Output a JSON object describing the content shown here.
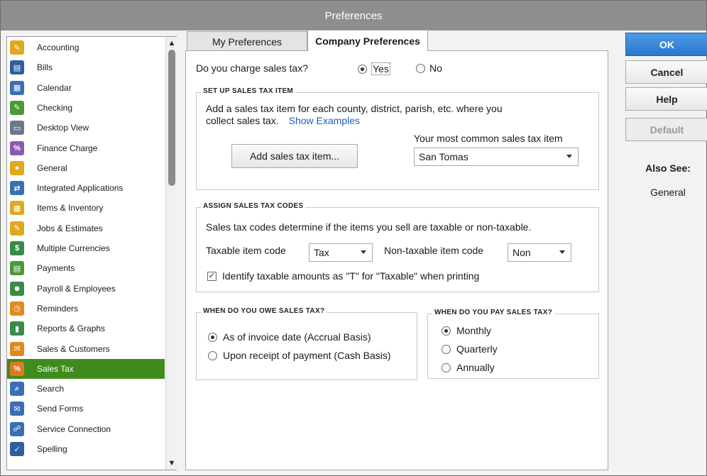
{
  "window": {
    "title": "Preferences"
  },
  "sidebar": {
    "items": [
      {
        "label": "Accounting",
        "icon": "accounting-icon",
        "color": "#e0a81e",
        "glyph": "✎"
      },
      {
        "label": "Bills",
        "icon": "bills-icon",
        "color": "#2e5e9e",
        "glyph": "▤"
      },
      {
        "label": "Calendar",
        "icon": "calendar-icon",
        "color": "#3a6eb5",
        "glyph": "▦"
      },
      {
        "label": "Checking",
        "icon": "checking-icon",
        "color": "#4a9a3a",
        "glyph": "✎"
      },
      {
        "label": "Desktop View",
        "icon": "desktop-view-icon",
        "color": "#6a7a8a",
        "glyph": "▭"
      },
      {
        "label": "Finance Charge",
        "icon": "finance-charge-icon",
        "color": "#8a5ab0",
        "glyph": "%"
      },
      {
        "label": "General",
        "icon": "general-icon",
        "color": "#e0a81e",
        "glyph": "●"
      },
      {
        "label": "Integrated Applications",
        "icon": "integrated-applications-icon",
        "color": "#3a6eb5",
        "glyph": "⇄"
      },
      {
        "label": "Items & Inventory",
        "icon": "items-inventory-icon",
        "color": "#e0a81e",
        "glyph": "▩"
      },
      {
        "label": "Jobs & Estimates",
        "icon": "jobs-estimates-icon",
        "color": "#e0a81e",
        "glyph": "✎"
      },
      {
        "label": "Multiple Currencies",
        "icon": "multiple-currencies-icon",
        "color": "#3b8a4a",
        "glyph": "$"
      },
      {
        "label": "Payments",
        "icon": "payments-icon",
        "color": "#4a9a3a",
        "glyph": "▤"
      },
      {
        "label": "Payroll & Employees",
        "icon": "payroll-employees-icon",
        "color": "#3b8a4a",
        "glyph": "☻"
      },
      {
        "label": "Reminders",
        "icon": "reminders-icon",
        "color": "#e08a1e",
        "glyph": "◷"
      },
      {
        "label": "Reports & Graphs",
        "icon": "reports-graphs-icon",
        "color": "#3b8a4a",
        "glyph": "▮"
      },
      {
        "label": "Sales & Customers",
        "icon": "sales-customers-icon",
        "color": "#e08a1e",
        "glyph": "✉"
      },
      {
        "label": "Sales Tax",
        "icon": "sales-tax-icon",
        "color": "#e07a1e",
        "glyph": "%"
      },
      {
        "label": "Search",
        "icon": "search-icon",
        "color": "#3a6eb5",
        "glyph": "⌕"
      },
      {
        "label": "Send Forms",
        "icon": "send-forms-icon",
        "color": "#3a6eb5",
        "glyph": "✉"
      },
      {
        "label": "Service Connection",
        "icon": "service-connection-icon",
        "color": "#3a6eb5",
        "glyph": "☍"
      },
      {
        "label": "Spelling",
        "icon": "spelling-icon",
        "color": "#2e5e9e",
        "glyph": "✓"
      }
    ],
    "selected_index": 16,
    "selected_color": "#3f8c1e"
  },
  "tabs": [
    {
      "label": "My Preferences",
      "underline": "M"
    },
    {
      "label": "Company Preferences",
      "underline": "C"
    }
  ],
  "charge": {
    "question": "Do you charge sales tax?",
    "yes_label": "Yes",
    "no_label": "No",
    "selected": "yes"
  },
  "setup": {
    "title": "SET UP SALES TAX ITEM",
    "desc_line1": "Add a sales tax item for each county, district, parish, etc. where you",
    "desc_line2": "collect sales tax.",
    "show_examples": "Show Examples",
    "add_button": "Add sales tax item...",
    "common_label": "Your most common sales tax item",
    "common_value": "San Tomas"
  },
  "assign": {
    "title": "ASSIGN SALES TAX CODES",
    "desc": "Sales tax codes determine if the items you sell are taxable or non-taxable.",
    "taxable_label": "Taxable item code",
    "taxable_value": "Tax",
    "nontaxable_label": "Non-taxable item code",
    "nontaxable_value": "Non",
    "identify_label": "Identify taxable amounts as \"T\" for \"Taxable\" when printing",
    "identify_checked": true
  },
  "owe": {
    "title": "WHEN DO YOU OWE SALES TAX?",
    "options": [
      "As of invoice date (Accrual Basis)",
      "Upon receipt of payment (Cash Basis)"
    ],
    "selected_index": 0
  },
  "pay": {
    "title": "WHEN DO YOU PAY SALES TAX?",
    "options": [
      "Monthly",
      "Quarterly",
      "Annually"
    ],
    "selected_index": 0
  },
  "actions": {
    "ok": "OK",
    "cancel": "Cancel",
    "help": "Help",
    "default": "Default",
    "also_see_title": "Also See:",
    "also_see_link": "General"
  }
}
